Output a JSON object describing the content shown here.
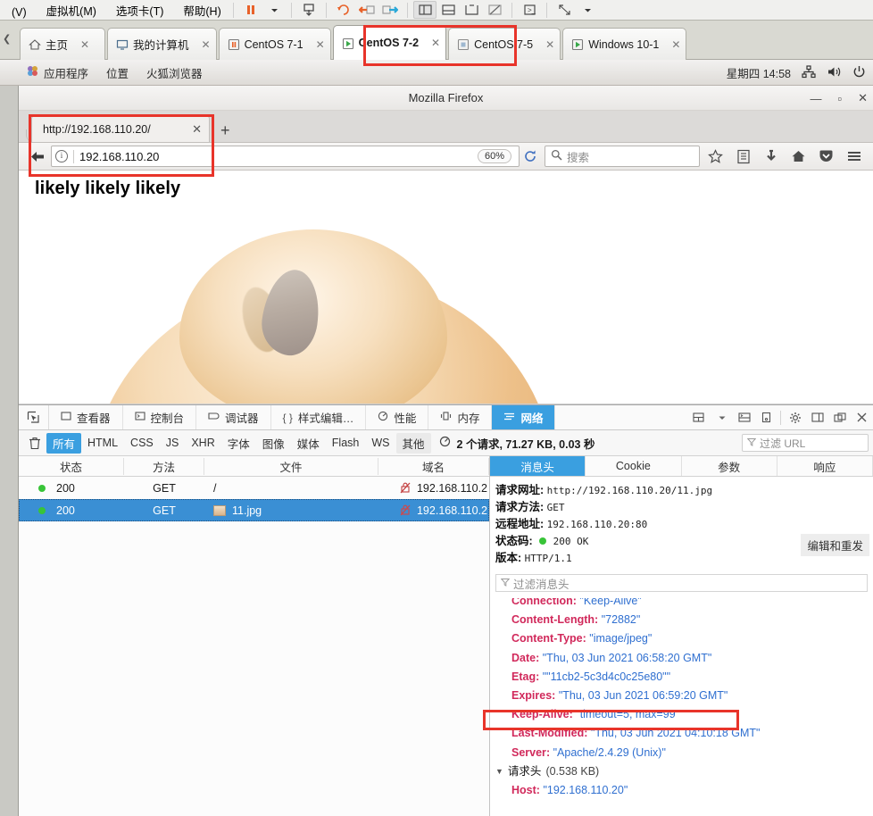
{
  "vmware": {
    "menu_items": [
      {
        "label": "(V)",
        "accel": ""
      },
      {
        "label": "虚拟机(M)",
        "accel": "M"
      },
      {
        "label": "选项卡(T)",
        "accel": "T"
      },
      {
        "label": "帮助(H)",
        "accel": "H"
      }
    ],
    "tabs": [
      {
        "label": "主页",
        "icon": "home-icon",
        "active": false
      },
      {
        "label": "我的计算机",
        "icon": "computer-icon",
        "active": false
      },
      {
        "label": "CentOS 7-1",
        "icon": "vm-paused-icon",
        "active": false
      },
      {
        "label": "CentOS 7-2",
        "icon": "vm-running-icon",
        "active": true
      },
      {
        "label": "CentOS 7-5",
        "icon": "vm-stopped-icon",
        "active": false
      },
      {
        "label": "Windows 10-1",
        "icon": "vm-running-icon",
        "active": false
      }
    ],
    "tab_close_label": "✕"
  },
  "gnome": {
    "applications": "应用程序",
    "places": "位置",
    "app_name": "火狐浏览器",
    "clock": "星期四 14:58",
    "tray": [
      "network-icon",
      "volume-icon",
      "power-icon"
    ]
  },
  "firefox": {
    "window_title": "Mozilla Firefox",
    "window_buttons": {
      "minimize": "—",
      "maximize": "▫",
      "close": "✕"
    },
    "tab": {
      "title": "http://192.168.110.20/",
      "close": "✕"
    },
    "new_tab": "+",
    "urlbar": {
      "value": "192.168.110.20",
      "zoom": "60%"
    },
    "search": {
      "placeholder": "搜索"
    },
    "nav_icons": [
      "bookmark-star-icon",
      "library-icon",
      "download-icon",
      "home-icon",
      "pocket-icon",
      "menu-hamburger-icon"
    ]
  },
  "page": {
    "heading": "likely likely likely"
  },
  "devtools": {
    "tabs": [
      {
        "label": "查看器",
        "icon": "inspector-icon",
        "active": false
      },
      {
        "label": "控制台",
        "icon": "console-icon",
        "active": false
      },
      {
        "label": "调试器",
        "icon": "debugger-icon",
        "active": false
      },
      {
        "label": "样式编辑…",
        "icon": "style-editor-icon",
        "active": false
      },
      {
        "label": "性能",
        "icon": "performance-icon",
        "active": false
      },
      {
        "label": "内存",
        "icon": "memory-icon",
        "active": false
      },
      {
        "label": "网络",
        "icon": "network-icon",
        "active": true
      }
    ],
    "right_icons": [
      "layout-icon",
      "split-console-icon",
      "responsive-mode-icon",
      "gear-icon",
      "dock-side-icon",
      "dock-window-icon",
      "close-icon"
    ],
    "filters": [
      {
        "label": "所有",
        "selected": true
      },
      {
        "label": "HTML",
        "selected": false
      },
      {
        "label": "CSS",
        "selected": false
      },
      {
        "label": "JS",
        "selected": false
      },
      {
        "label": "XHR",
        "selected": false
      },
      {
        "label": "字体",
        "selected": false
      },
      {
        "label": "图像",
        "selected": false
      },
      {
        "label": "媒体",
        "selected": false
      },
      {
        "label": "Flash",
        "selected": false
      },
      {
        "label": "WS",
        "selected": false
      },
      {
        "label": "其他",
        "selected": false
      }
    ],
    "status_summary": "2 个请求, 71.27 KB, 0.03 秒",
    "url_filter_placeholder": "过滤 URL",
    "network_table": {
      "columns": [
        "状态",
        "方法",
        "文件",
        "域名"
      ],
      "rows": [
        {
          "status": "200",
          "method": "GET",
          "file": "/",
          "domain": "192.168.110.2",
          "selected": false,
          "has_file_icon": false
        },
        {
          "status": "200",
          "method": "GET",
          "file": "11.jpg",
          "domain": "192.168.110.2",
          "selected": true,
          "has_file_icon": true
        }
      ]
    },
    "details": {
      "tabs": [
        {
          "label": "消息头",
          "active": true
        },
        {
          "label": "Cookie",
          "active": false
        },
        {
          "label": "参数",
          "active": false
        },
        {
          "label": "响应",
          "active": false
        }
      ],
      "summary": [
        {
          "key": "请求网址:",
          "value": "http://192.168.110.20/11.jpg"
        },
        {
          "key": "请求方法:",
          "value": "GET"
        },
        {
          "key": "远程地址:",
          "value": "192.168.110.20:80"
        },
        {
          "key": "状态码:",
          "value": "200 OK",
          "has_dot": true
        },
        {
          "key": "版本:",
          "value": "HTTP/1.1"
        }
      ],
      "resend_button": "编辑和重发",
      "header_filter_placeholder": "过滤消息头",
      "response_headers": [
        {
          "name": "Connection",
          "value": "\"Keep-Alive\""
        },
        {
          "name": "Content-Length",
          "value": "\"72882\""
        },
        {
          "name": "Content-Type",
          "value": "\"image/jpeg\""
        },
        {
          "name": "Date",
          "value": "\"Thu, 03 Jun 2021 06:58:20 GMT\""
        },
        {
          "name": "Etag",
          "value": "\"\"11cb2-5c3d4c0c25e80\"\""
        },
        {
          "name": "Expires",
          "value": "\"Thu, 03 Jun 2021 06:59:20 GMT\"",
          "highlighted": true
        },
        {
          "name": "Keep-Alive",
          "value": "\"timeout=5, max=99\""
        },
        {
          "name": "Last-Modified",
          "value": "\"Thu, 03 Jun 2021 04:10:18 GMT\""
        },
        {
          "name": "Server",
          "value": "\"Apache/2.4.29 (Unix)\""
        }
      ],
      "request_headers_group": {
        "label": "请求头",
        "size": "(0.538 KB)",
        "expanded": true
      },
      "request_headers": [
        {
          "name": "Host",
          "value": "\"192.168.110.20\""
        }
      ]
    }
  },
  "colors": {
    "accent_blue": "#3a9fe0",
    "selection_blue": "#3a8fd4",
    "header_key_red": "#d1295b",
    "header_value_blue": "#2f6fd0",
    "highlight_red": "#e8342a",
    "status_green": "#38c438"
  }
}
